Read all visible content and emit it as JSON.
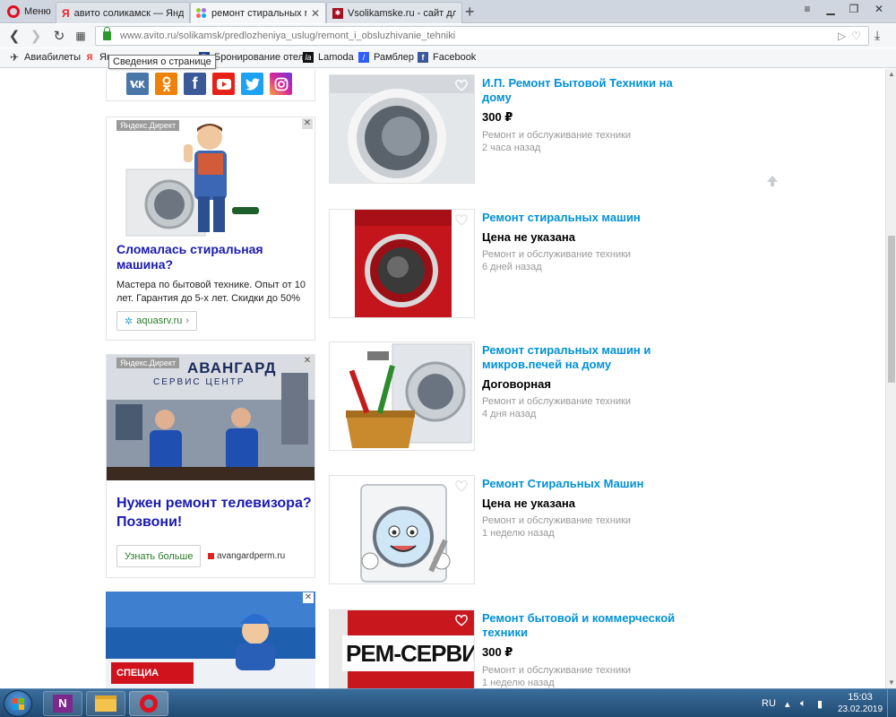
{
  "browser": {
    "menu_label": "Меню",
    "tabs": [
      {
        "title": "авито соликамск — Яндек",
        "favicon": "yandex-icon"
      },
      {
        "title": "ремонт стиральных маши",
        "favicon": "avito-icon"
      },
      {
        "title": "Vsolikamske.ru - сайт для",
        "favicon": "vsolikamske-icon"
      }
    ],
    "url": "www.avito.ru/solikamsk/predlozheniya_uslug/remont_i_obsluzhivanie_tehniki",
    "tooltip": "Сведения о странице",
    "bookmarks": [
      {
        "label": "Авиабилеты"
      },
      {
        "label": "Ян"
      },
      {
        "label": "Бронирование отел"
      },
      {
        "label": "Lamoda"
      },
      {
        "label": "Рамблер"
      },
      {
        "label": "Facebook"
      }
    ]
  },
  "social": {
    "icons": [
      "vk-icon",
      "odnoklassniki-icon",
      "facebook-icon",
      "youtube-icon",
      "twitter-icon",
      "instagram-icon"
    ]
  },
  "ads": [
    {
      "label": "Яндекс.Директ",
      "title": "Сломалась стиральная машина?",
      "text": "Мастера по бытовой технике. Опыт от 10 лет. Гарантия до 5-х лет. Скидки до 50%",
      "link": "aquasrv.ru"
    },
    {
      "label": "Яндекс.Директ",
      "image_sign": "АВАНГАРД",
      "image_sign_sub": "СЕРВИС ЦЕНТР",
      "title": "Нужен ремонт телевизора? Позвони!",
      "button": "Узнать больше",
      "link": "avangardperm.ru"
    },
    {
      "image_text": "СПЕЦИА"
    }
  ],
  "listings": [
    {
      "title": "И.П. Ремонт Бытовой Техники на дому",
      "price": "300 ₽",
      "category": "Ремонт и обслуживание техники",
      "date": "2 часа назад"
    },
    {
      "title": "Ремонт стиральных машин",
      "price": "Цена не указана",
      "category": "Ремонт и обслуживание техники",
      "date": "6 дней назад"
    },
    {
      "title": "Ремонт стиральных машин и микров.печей на дому",
      "price": "Договорная",
      "category": "Ремонт и обслуживание техники",
      "date": "4 дня назад"
    },
    {
      "title": "Ремонт Стиральных Машин",
      "price": "Цена не указана",
      "category": "Ремонт и обслуживание техники",
      "date": "1 неделю назад"
    },
    {
      "title": "Ремонт бытовой и коммерческой техники",
      "price": "300 ₽",
      "category": "Ремонт и обслуживание техники",
      "date": "1 неделю назад",
      "image_text": "РЕМ-СЕРВИС"
    }
  ],
  "taskbar": {
    "lang": "RU",
    "time": "15:03",
    "date": "23.02.2019"
  },
  "colors": {
    "link_blue": "#0091d9",
    "ad_title": "#1a1ab0",
    "muted": "#999999"
  }
}
